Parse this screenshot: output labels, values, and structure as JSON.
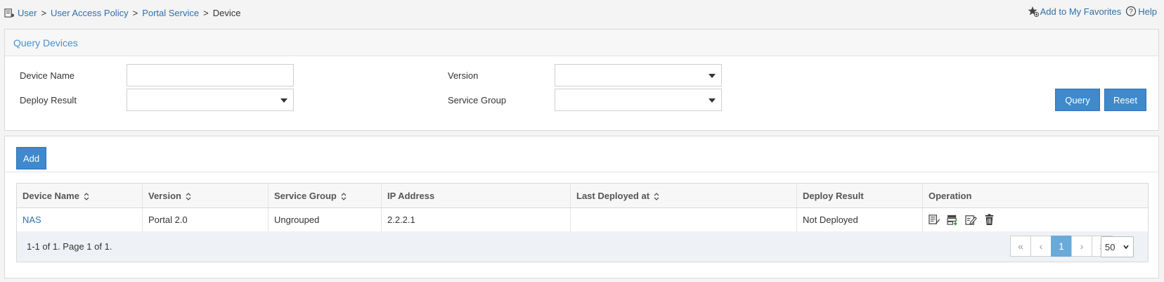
{
  "breadcrumb": {
    "items": [
      "User",
      "User Access Policy",
      "Portal Service"
    ],
    "separator": ">",
    "current": "Device"
  },
  "header_links": {
    "favorites": "Add to My Favorites",
    "help": "Help"
  },
  "query": {
    "title": "Query Devices",
    "device_name_label": "Device Name",
    "device_name_value": "",
    "version_label": "Version",
    "version_value": "",
    "deploy_result_label": "Deploy Result",
    "deploy_result_value": "",
    "service_group_label": "Service Group",
    "service_group_value": "",
    "query_button": "Query",
    "reset_button": "Reset"
  },
  "list": {
    "add_button": "Add",
    "columns": [
      "Device Name",
      "Version",
      "Service Group",
      "IP Address",
      "Last Deployed at",
      "Deploy Result",
      "Operation"
    ],
    "rows": [
      {
        "device_name": "NAS",
        "version": "Portal 2.0",
        "service_group": "Ungrouped",
        "ip_address": "2.2.2.1",
        "last_deployed_at": "",
        "deploy_result": "Not Deployed"
      }
    ],
    "operation_icons": [
      "detail-icon",
      "deploy-icon",
      "edit-icon",
      "delete-icon"
    ]
  },
  "pagination": {
    "info": "1-1 of 1. Page 1 of 1.",
    "first": "«",
    "prev": "‹",
    "current_page": "1",
    "next": "›",
    "last": "»",
    "page_size": "50"
  },
  "colors": {
    "accent": "#3f89cc",
    "link": "#2f6fae",
    "active_page": "#6aaad9"
  }
}
